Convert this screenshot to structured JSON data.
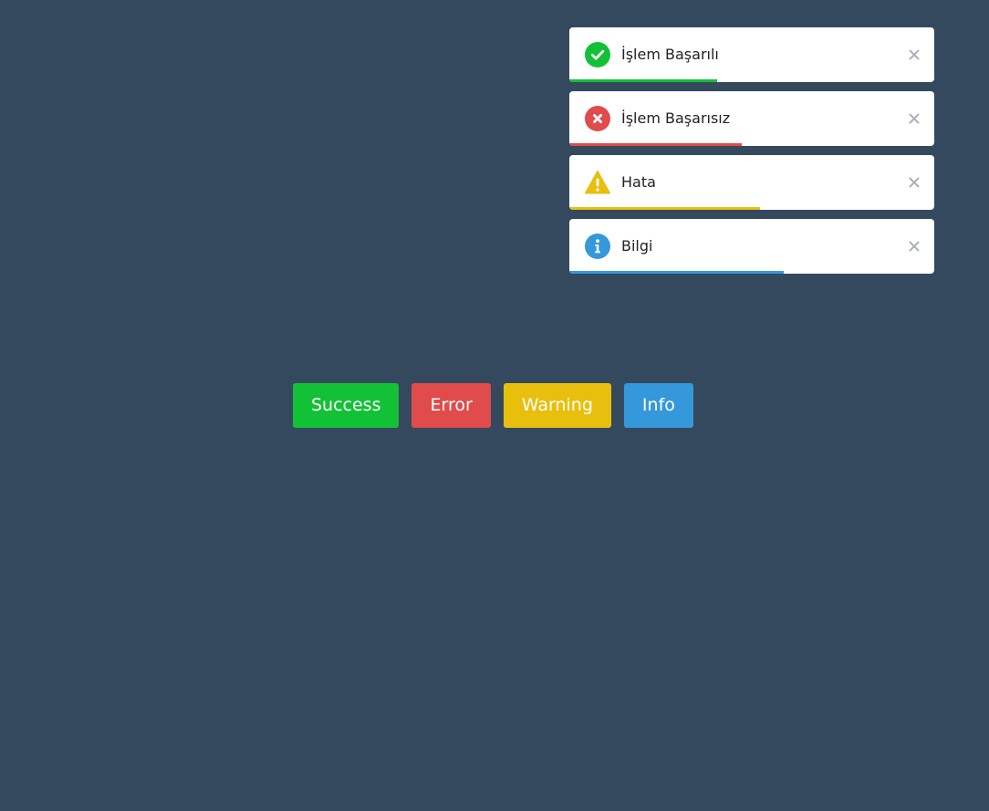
{
  "page": {
    "background_color": "#34495e"
  },
  "toasts": [
    {
      "message": "İşlem Başarılı",
      "icon": "check-circle-icon",
      "color": "#13c136",
      "progress": 0.405,
      "close_icon": "close-icon"
    },
    {
      "message": "İşlem Başarısız",
      "icon": "x-circle-icon",
      "color": "#e04b4b",
      "progress": 0.4725,
      "close_icon": "close-icon"
    },
    {
      "message": "Hata",
      "icon": "warning-triangle-icon",
      "color": "#e9bf0e",
      "progress": 0.5225,
      "close_icon": "close-icon"
    },
    {
      "message": "Bilgi",
      "icon": "info-circle-icon",
      "color": "#3498db",
      "progress": 0.5875,
      "close_icon": "close-icon"
    }
  ],
  "close_icon_color": "#aab0c0",
  "buttons": [
    {
      "label": "Success",
      "color": "#13c136"
    },
    {
      "label": "Error",
      "color": "#e04b4b"
    },
    {
      "label": "Warning",
      "color": "#e9bf0e"
    },
    {
      "label": "Info",
      "color": "#3498db"
    }
  ]
}
